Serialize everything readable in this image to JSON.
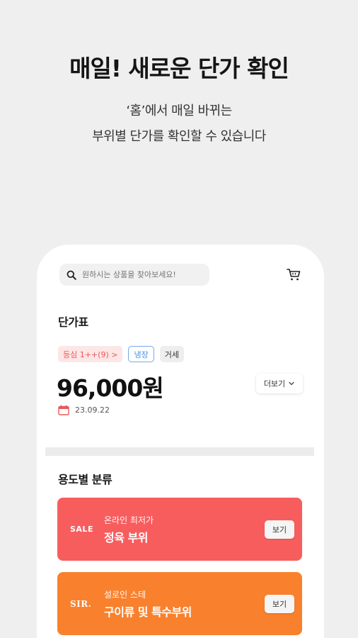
{
  "hero": {
    "title": "매일! 새로운 단가 확인",
    "subtitle_line1": "‘홈’에서 매일 바뀌는",
    "subtitle_line2": "부위별 단가를 확인할 수 있습니다"
  },
  "search": {
    "placeholder": "원하시는 상품을 찾아보세요!"
  },
  "price_section": {
    "title": "단가표",
    "tags": {
      "grade": "등심 1++(9) >",
      "storage": "냉장",
      "channel": "거세"
    },
    "price": "96,000원",
    "more_label": "더보기",
    "date": "23.09.22"
  },
  "category_section": {
    "title": "용도별 분류",
    "cards": [
      {
        "badge": "SALE",
        "subtitle": "온라인 최저가",
        "title": "정육 부위",
        "button": "보기",
        "color": "#f85d5e"
      },
      {
        "badge": "SIR.",
        "subtitle": "설로인 스테",
        "title": "구이류 및 특수부위",
        "button": "보기",
        "color": "#f9812d"
      }
    ]
  },
  "icons": {
    "search": "search-icon",
    "cart": "cart-icon",
    "chevron": "chevron-down-icon",
    "calendar": "calendar-icon"
  }
}
